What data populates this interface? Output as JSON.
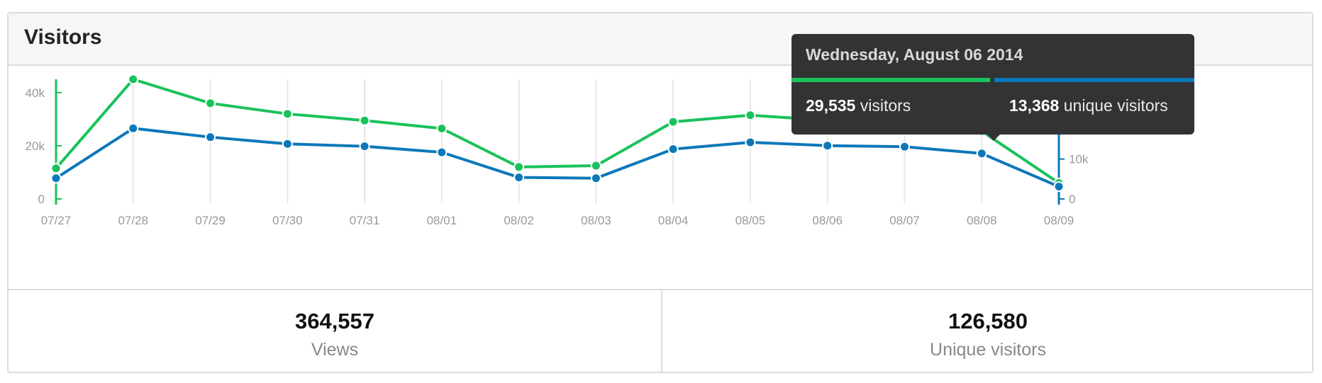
{
  "panel": {
    "title": "Visitors"
  },
  "chart_data": {
    "type": "line",
    "categories": [
      "07/27",
      "07/28",
      "07/29",
      "07/30",
      "07/31",
      "08/01",
      "08/02",
      "08/03",
      "08/04",
      "08/05",
      "08/06",
      "08/07",
      "08/08",
      "08/09"
    ],
    "series": [
      {
        "axis": "left",
        "color": "#19c25a",
        "values": [
          11500,
          45000,
          36000,
          32000,
          29500,
          26500,
          12000,
          12500,
          29000,
          31500,
          29535,
          28000,
          25500,
          6000
        ]
      },
      {
        "axis": "right",
        "color": "#0d78b8",
        "values": [
          5200,
          17700,
          15500,
          13800,
          13200,
          11700,
          5400,
          5200,
          12500,
          14200,
          13368,
          13100,
          11400,
          3100
        ]
      }
    ],
    "left_axis": {
      "ticks": [
        "40k",
        "20k",
        "0"
      ],
      "tick_values": [
        40000,
        20000,
        0
      ],
      "ylim": [
        0,
        45000
      ],
      "color": "#19c25a"
    },
    "right_axis": {
      "ticks": [
        "30k",
        "20k",
        "10k",
        "0"
      ],
      "tick_values": [
        30000,
        20000,
        10000,
        0
      ],
      "ylim": [
        0,
        30000
      ],
      "color": "#0d78b8"
    },
    "grid": "vertical"
  },
  "tooltip": {
    "date": "Wednesday, August 06 2014",
    "visitors_value": "29,535",
    "visitors_label": "visitors",
    "unique_value": "13,368",
    "unique_label": "unique visitors"
  },
  "stats": [
    {
      "value": "364,557",
      "label": "Views"
    },
    {
      "value": "126,580",
      "label": "Unique visitors"
    }
  ],
  "colors": {
    "green": "#19c25a",
    "blue": "#0d78b8",
    "grid": "#e6e6e6",
    "tick_text": "#999999"
  }
}
